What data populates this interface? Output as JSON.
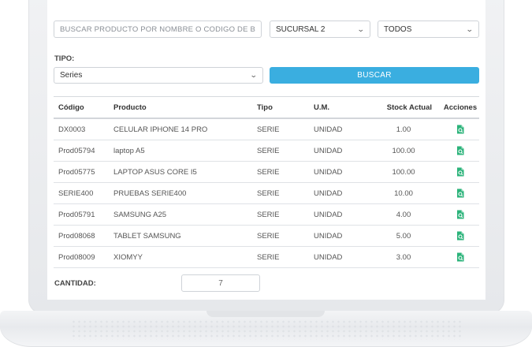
{
  "search": {
    "placeholder": "BUSCAR PRODUCTO POR NOMBRE O CODIGO DE BARRAS"
  },
  "filters": {
    "sucursal": "SUCURSAL 2",
    "estado": "TODOS",
    "tipo_label": "TIPO:",
    "tipo_value": "Series"
  },
  "buttons": {
    "buscar": "BUSCAR"
  },
  "table": {
    "headers": {
      "codigo": "Código",
      "producto": "Producto",
      "tipo": "Tipo",
      "um": "U.M.",
      "stock": "Stock Actual",
      "acciones": "Acciones"
    },
    "rows": [
      {
        "codigo": "DX0003",
        "producto": "CELULAR IPHONE 14 PRO",
        "tipo": "SERIE",
        "um": "UNIDAD",
        "stock": "1.00"
      },
      {
        "codigo": "Prod05794",
        "producto": "laptop A5",
        "tipo": "SERIE",
        "um": "UNIDAD",
        "stock": "100.00"
      },
      {
        "codigo": "Prod05775",
        "producto": "LAPTOP ASUS CORE I5",
        "tipo": "SERIE",
        "um": "UNIDAD",
        "stock": "100.00"
      },
      {
        "codigo": "SERIE400",
        "producto": "PRUEBAS SERIE400",
        "tipo": "SERIE",
        "um": "UNIDAD",
        "stock": "10.00"
      },
      {
        "codigo": "Prod05791",
        "producto": "SAMSUNG A25",
        "tipo": "SERIE",
        "um": "UNIDAD",
        "stock": "4.00"
      },
      {
        "codigo": "Prod08068",
        "producto": "TABLET SAMSUNG",
        "tipo": "SERIE",
        "um": "UNIDAD",
        "stock": "5.00"
      },
      {
        "codigo": "Prod08009",
        "producto": "XIOMYY",
        "tipo": "SERIE",
        "um": "UNIDAD",
        "stock": "3.00"
      }
    ],
    "action_icon": "file-search-icon"
  },
  "cantidad": {
    "label": "CANTIDAD:",
    "value": "7"
  },
  "colors": {
    "accent": "#3aaee0",
    "action_icon": "#2bb37a"
  }
}
